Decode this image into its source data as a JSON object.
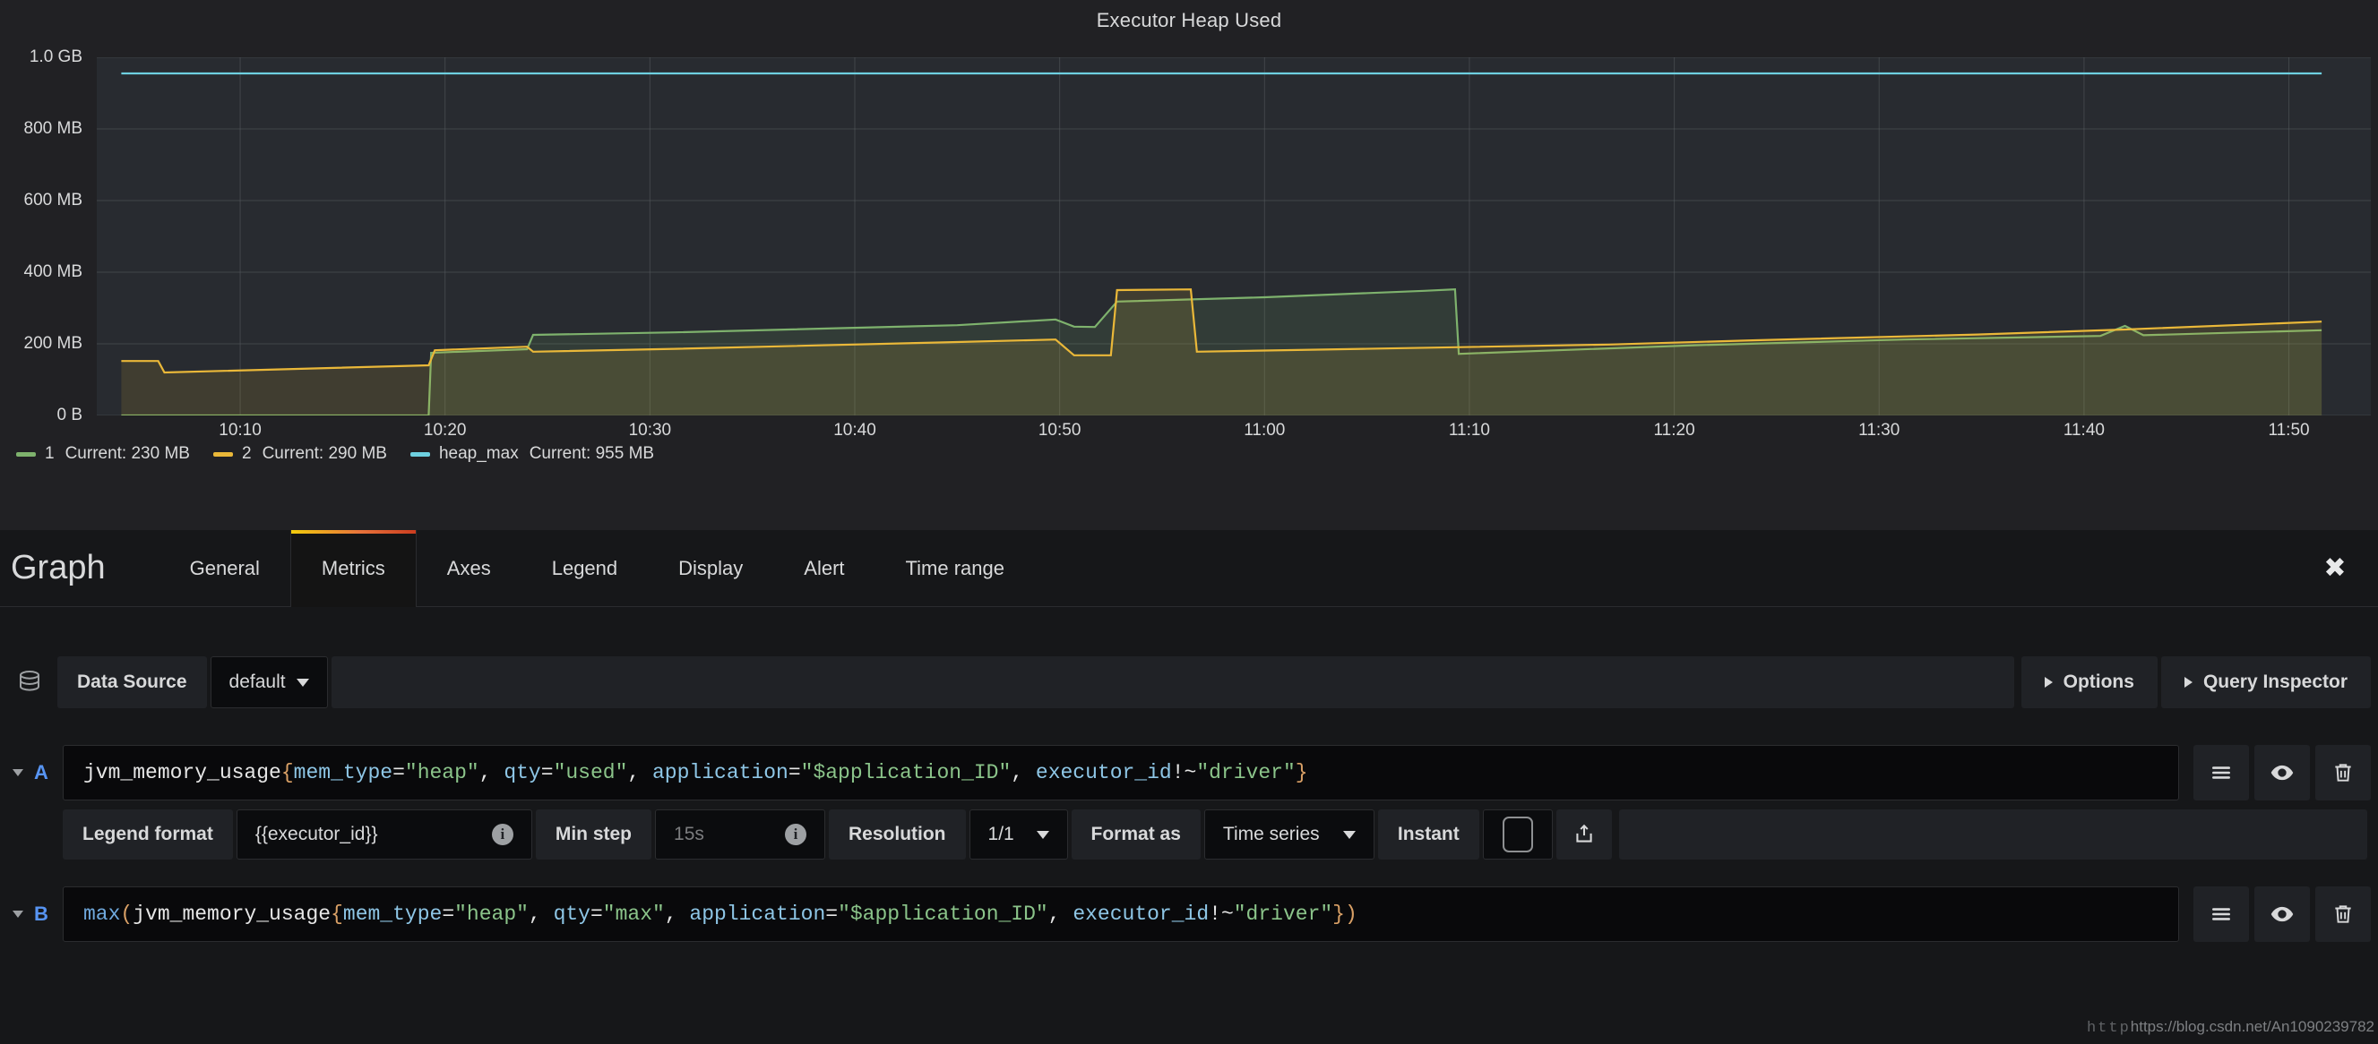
{
  "panel": {
    "title": "Executor Heap Used"
  },
  "chart_data": {
    "type": "line",
    "title": "Executor Heap Used",
    "xlabel": "",
    "ylabel": "",
    "grid": true,
    "legend_position": "bottom",
    "ylim": [
      0,
      1073741824
    ],
    "ytick_labels": [
      "1.0 GB",
      "800 MB",
      "600 MB",
      "400 MB",
      "200 MB",
      "0 B"
    ],
    "ytick_values": [
      1000,
      800,
      600,
      400,
      200,
      0
    ],
    "xtick_labels": [
      "10:10",
      "10:20",
      "10:30",
      "10:40",
      "10:50",
      "11:00",
      "11:10",
      "11:20",
      "11:30",
      "11:40",
      "11:50"
    ],
    "unit": "MB",
    "series": [
      {
        "name": "1",
        "color": "#7eb26d",
        "current": "230 MB",
        "points": [
          [
            10.07,
            0
          ],
          [
            10.32,
            0
          ],
          [
            10.322,
            175
          ],
          [
            10.4,
            185
          ],
          [
            10.405,
            225
          ],
          [
            10.52,
            232
          ],
          [
            10.75,
            252
          ],
          [
            10.83,
            268
          ],
          [
            10.845,
            248
          ],
          [
            10.862,
            247
          ],
          [
            10.88,
            318
          ],
          [
            11.0,
            330
          ],
          [
            11.13,
            348
          ],
          [
            11.155,
            352
          ],
          [
            11.158,
            172
          ],
          [
            11.35,
            196
          ],
          [
            11.52,
            212
          ],
          [
            11.68,
            222
          ],
          [
            11.7,
            250
          ],
          [
            11.715,
            224
          ],
          [
            11.86,
            238
          ]
        ]
      },
      {
        "name": "2",
        "color": "#eab839",
        "current": "290 MB",
        "points": [
          [
            10.07,
            152
          ],
          [
            10.1,
            152
          ],
          [
            10.105,
            120
          ],
          [
            10.32,
            140
          ],
          [
            10.325,
            182
          ],
          [
            10.4,
            192
          ],
          [
            10.405,
            178
          ],
          [
            10.52,
            186
          ],
          [
            10.75,
            205
          ],
          [
            10.83,
            212
          ],
          [
            10.845,
            168
          ],
          [
            10.875,
            168
          ],
          [
            10.88,
            350
          ],
          [
            10.94,
            352
          ],
          [
            10.945,
            178
          ],
          [
            11.08,
            186
          ],
          [
            11.28,
            198
          ],
          [
            11.4,
            210
          ],
          [
            11.58,
            226
          ],
          [
            11.7,
            240
          ],
          [
            11.86,
            262
          ]
        ]
      },
      {
        "name": "heap_max",
        "color": "#6ed0e0",
        "current": "955 MB",
        "points": [
          [
            10.07,
            955
          ],
          [
            11.86,
            955
          ]
        ]
      }
    ]
  },
  "legend": [
    {
      "name": "1",
      "stat_label": "Current:",
      "value": "230 MB",
      "color": "#7eb26d"
    },
    {
      "name": "2",
      "stat_label": "Current:",
      "value": "290 MB",
      "color": "#eab839"
    },
    {
      "name": "heap_max",
      "stat_label": "Current:",
      "value": "955 MB",
      "color": "#6ed0e0"
    }
  ],
  "editor": {
    "title": "Graph",
    "tabs": [
      {
        "label": "General",
        "active": false
      },
      {
        "label": "Metrics",
        "active": true
      },
      {
        "label": "Axes",
        "active": false
      },
      {
        "label": "Legend",
        "active": false
      },
      {
        "label": "Display",
        "active": false
      },
      {
        "label": "Alert",
        "active": false
      },
      {
        "label": "Time range",
        "active": false
      }
    ],
    "close_label": "✖"
  },
  "datasource_row": {
    "label": "Data Source",
    "value": "default",
    "options_button": "Options",
    "query_inspector_button": "Query Inspector"
  },
  "queries": [
    {
      "letter": "A",
      "expression_tokens": [
        {
          "t": "jvm_memory_usage",
          "c": "tok-metric"
        },
        {
          "t": "{",
          "c": "tok-brace"
        },
        {
          "t": "mem_type",
          "c": "tok-label"
        },
        {
          "t": "=",
          "c": "tok-punct"
        },
        {
          "t": "\"heap\"",
          "c": "tok-str"
        },
        {
          "t": ", ",
          "c": "tok-punct"
        },
        {
          "t": "qty",
          "c": "tok-label"
        },
        {
          "t": "=",
          "c": "tok-punct"
        },
        {
          "t": "\"used\"",
          "c": "tok-str"
        },
        {
          "t": ", ",
          "c": "tok-punct"
        },
        {
          "t": "application",
          "c": "tok-label"
        },
        {
          "t": "=",
          "c": "tok-punct"
        },
        {
          "t": "\"$application_ID\"",
          "c": "tok-str"
        },
        {
          "t": ", ",
          "c": "tok-punct"
        },
        {
          "t": "executor_id",
          "c": "tok-label"
        },
        {
          "t": "!~",
          "c": "tok-punct"
        },
        {
          "t": "\"driver\"",
          "c": "tok-str"
        },
        {
          "t": "}",
          "c": "tok-brace"
        }
      ],
      "options": {
        "legend_format_label": "Legend format",
        "legend_format_value": "{{executor_id}}",
        "min_step_label": "Min step",
        "min_step_placeholder": "15s",
        "resolution_label": "Resolution",
        "resolution_value": "1/1",
        "format_as_label": "Format as",
        "format_as_value": "Time series",
        "instant_label": "Instant",
        "instant_checked": false
      }
    },
    {
      "letter": "B",
      "expression_tokens": [
        {
          "t": "max",
          "c": "tok-func"
        },
        {
          "t": "(",
          "c": "tok-brace"
        },
        {
          "t": "jvm_memory_usage",
          "c": "tok-metric"
        },
        {
          "t": "{",
          "c": "tok-brace"
        },
        {
          "t": "mem_type",
          "c": "tok-label"
        },
        {
          "t": "=",
          "c": "tok-punct"
        },
        {
          "t": "\"heap\"",
          "c": "tok-str"
        },
        {
          "t": ", ",
          "c": "tok-punct"
        },
        {
          "t": "qty",
          "c": "tok-label"
        },
        {
          "t": "=",
          "c": "tok-punct"
        },
        {
          "t": "\"max\"",
          "c": "tok-str"
        },
        {
          "t": ", ",
          "c": "tok-punct"
        },
        {
          "t": "application",
          "c": "tok-label"
        },
        {
          "t": "=",
          "c": "tok-punct"
        },
        {
          "t": "\"$application_ID\"",
          "c": "tok-str"
        },
        {
          "t": ", ",
          "c": "tok-punct"
        },
        {
          "t": "executor_id",
          "c": "tok-label"
        },
        {
          "t": "!~",
          "c": "tok-punct"
        },
        {
          "t": "\"driver\"",
          "c": "tok-str"
        },
        {
          "t": "}",
          "c": "tok-brace"
        },
        {
          "t": ")",
          "c": "tok-brace"
        }
      ]
    }
  ],
  "icons": {
    "datasource": "database-icon",
    "query_menu": "hamburger-icon",
    "query_toggle": "eye-icon",
    "query_remove": "trash-icon",
    "share": "share-icon"
  },
  "watermark": {
    "faint": "http",
    "text": "https://blog.csdn.net/An1090239782"
  }
}
